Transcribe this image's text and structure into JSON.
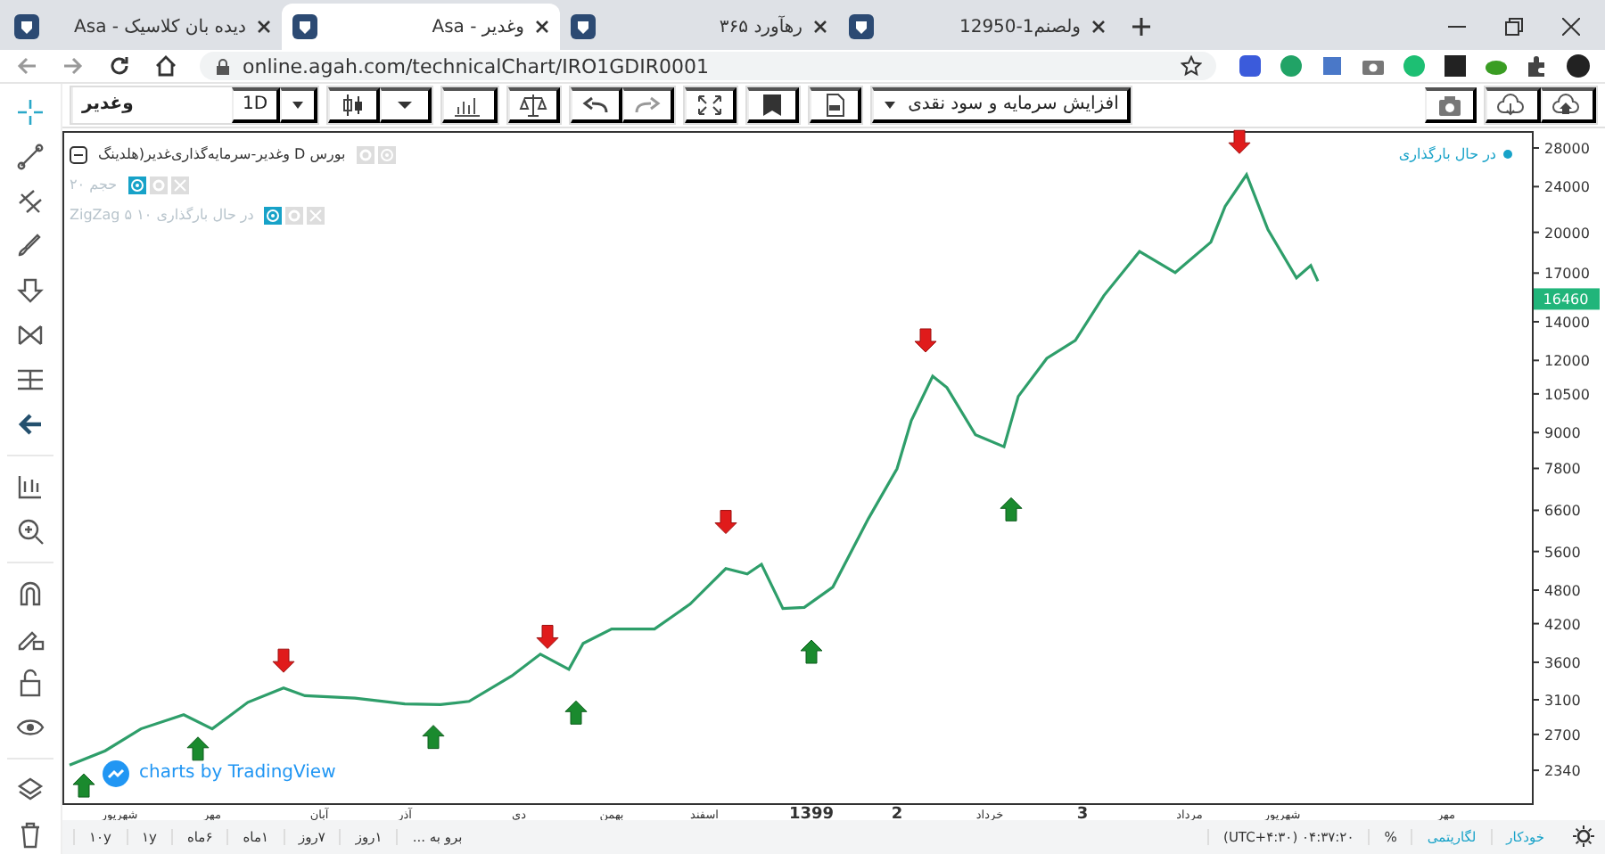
{
  "browser": {
    "tabs": [
      {
        "title": "ولصنم1-12950",
        "selected": false
      },
      {
        "title": "رهآورد ۳۶۵",
        "selected": false
      },
      {
        "title": "وغدیر - Asa",
        "selected": true
      },
      {
        "title": "دیده بان کلاسیک - Asa",
        "selected": false
      }
    ],
    "url": "online.agah.com/technicalChart/IRO1GDIR0001"
  },
  "toolbar": {
    "symbol": "وغدیر",
    "interval": "1D",
    "adjustment": "افزایش سرمایه و سود نقدی"
  },
  "legend": {
    "main": "بورس D وغدیر-سرمایه‌گذاری‌غدیر(هلدینگ",
    "studies": [
      {
        "name": "حجم ۲۰"
      },
      {
        "name": "ZigZag ۵ ۱۰ در حال بارگذاری"
      }
    ],
    "status": "در حال بارگذاری",
    "attribution": "charts by TradingView"
  },
  "chart": {
    "x_labels": [
      "مهر",
      "شهریور",
      "مرداد",
      "3",
      "خرداد",
      "2",
      "1399",
      "اسفند",
      "بهمن",
      "دی",
      "آذر",
      "آبان",
      "مهر",
      "شهریور"
    ],
    "y_labels": [
      "28000",
      "24000",
      "20000",
      "17000",
      "14000",
      "12000",
      "10500",
      "9000",
      "7800",
      "6600",
      "5600",
      "4800",
      "4200",
      "3600",
      "3100",
      "2700",
      "2340"
    ],
    "price_tag": "16460"
  },
  "bottom_bar": {
    "goto": "برو به ...",
    "ranges": [
      "۱روز",
      "۷روز",
      "۱ماه",
      "۶ماه",
      "۱y",
      "۱۰y"
    ],
    "time": "۰۴:۳۷:۲۰ (UTC+۴:۳۰)",
    "percent": "%",
    "log": {
      "label": "لگاریتمی",
      "on": true
    },
    "auto": {
      "label": "خودکار",
      "on": true
    }
  }
}
